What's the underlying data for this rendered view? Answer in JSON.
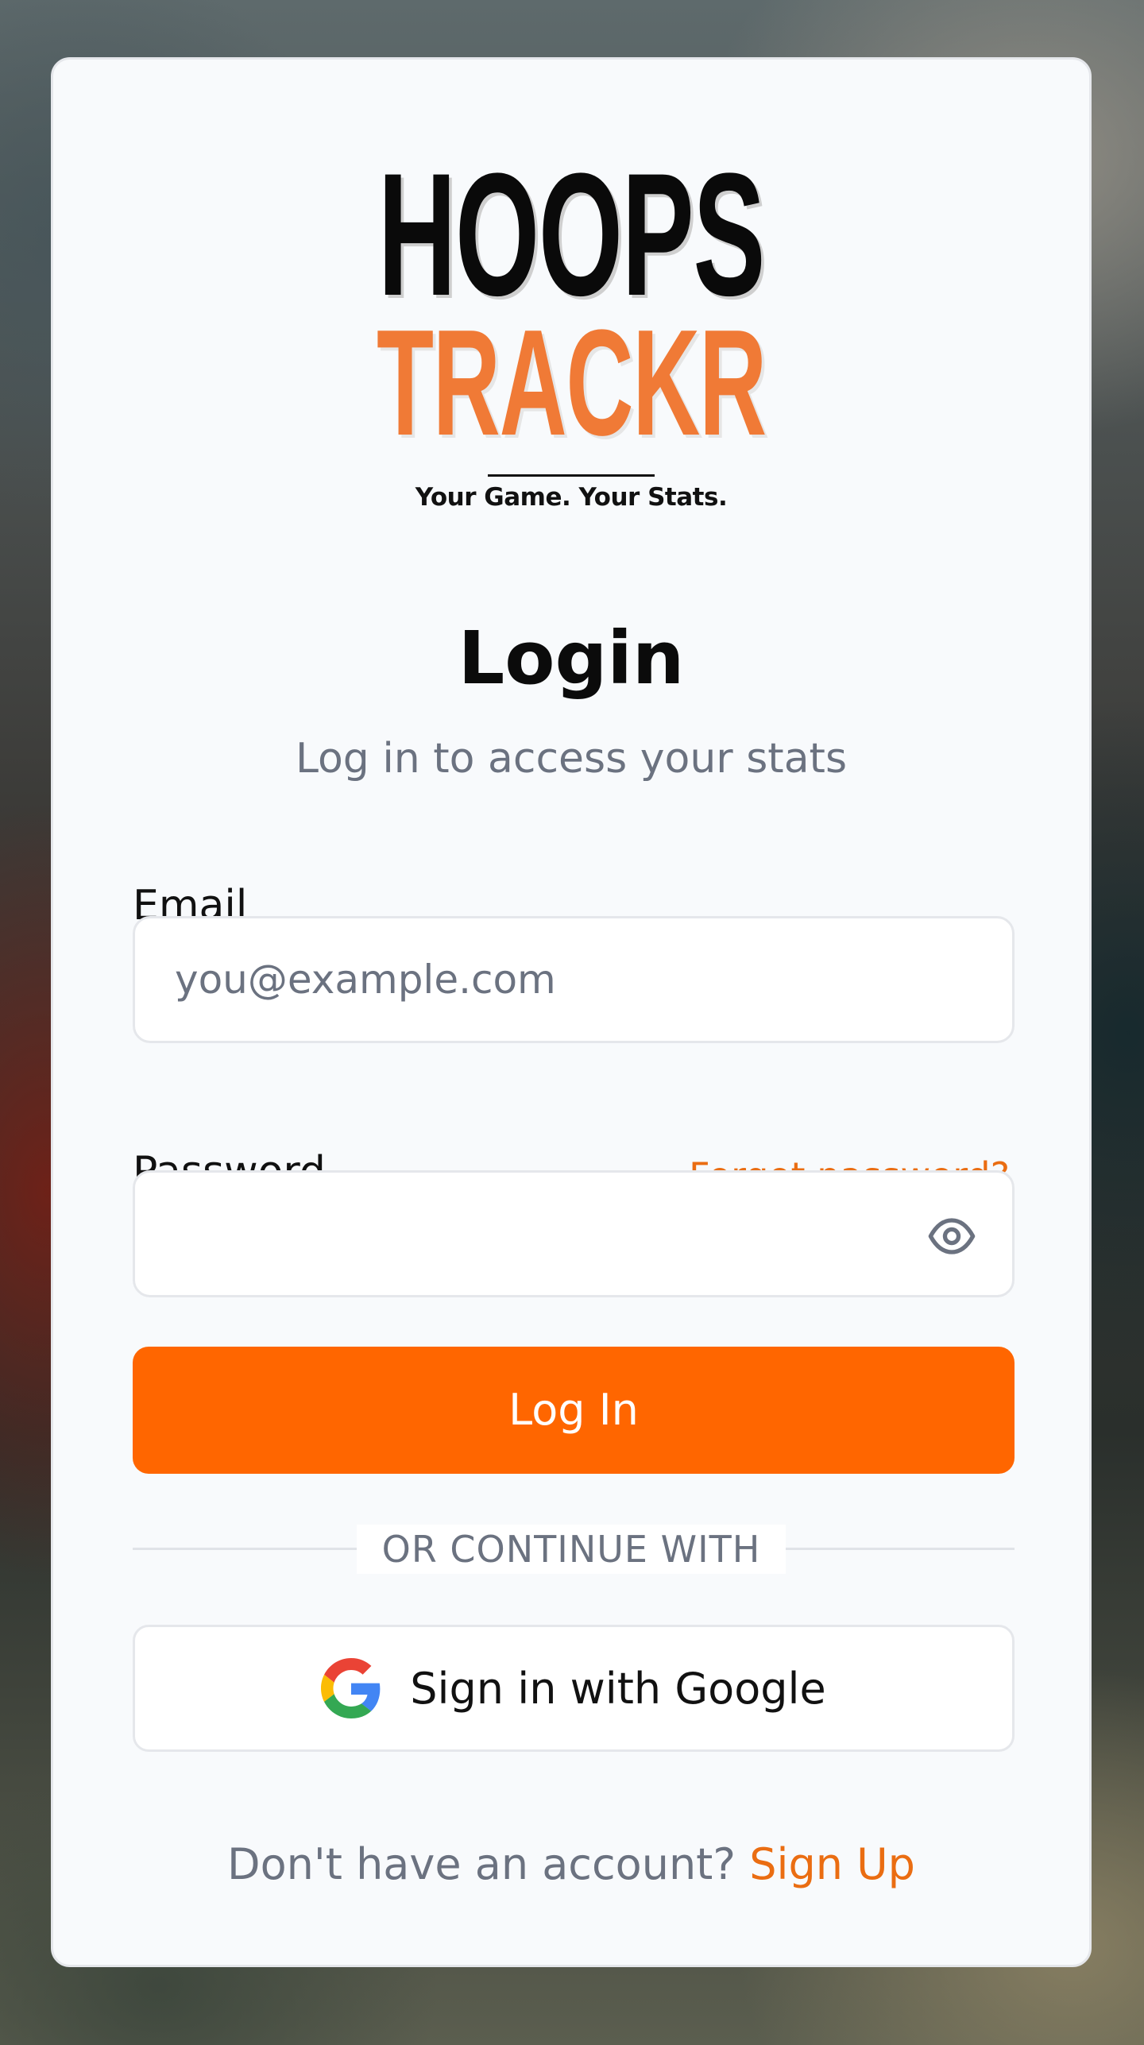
{
  "brand": {
    "logo_line1": "HOOPS",
    "logo_line2": "TRACKR",
    "tagline": "Your Game. Your Stats."
  },
  "page": {
    "title": "Login",
    "subtitle": "Log in to access your stats"
  },
  "form": {
    "email_label": "Email",
    "email_value": "",
    "email_placeholder": "you@example.com",
    "password_label": "Password",
    "password_value": "",
    "forgot_link": "Forgot password?",
    "password_toggle_icon": "eye-icon",
    "submit_label": "Log In"
  },
  "divider_text": "OR CONTINUE WITH",
  "oauth": {
    "google_label": "Sign in with Google",
    "google_icon": "google-icon"
  },
  "footer": {
    "prompt": "Don't have an account?",
    "signup_link": "Sign Up"
  },
  "colors": {
    "accent": "#ff6600",
    "link": "#ea6d12",
    "logo_orange": "#f07a36",
    "card_bg": "#f8fafc",
    "muted_text": "#6b7280"
  }
}
